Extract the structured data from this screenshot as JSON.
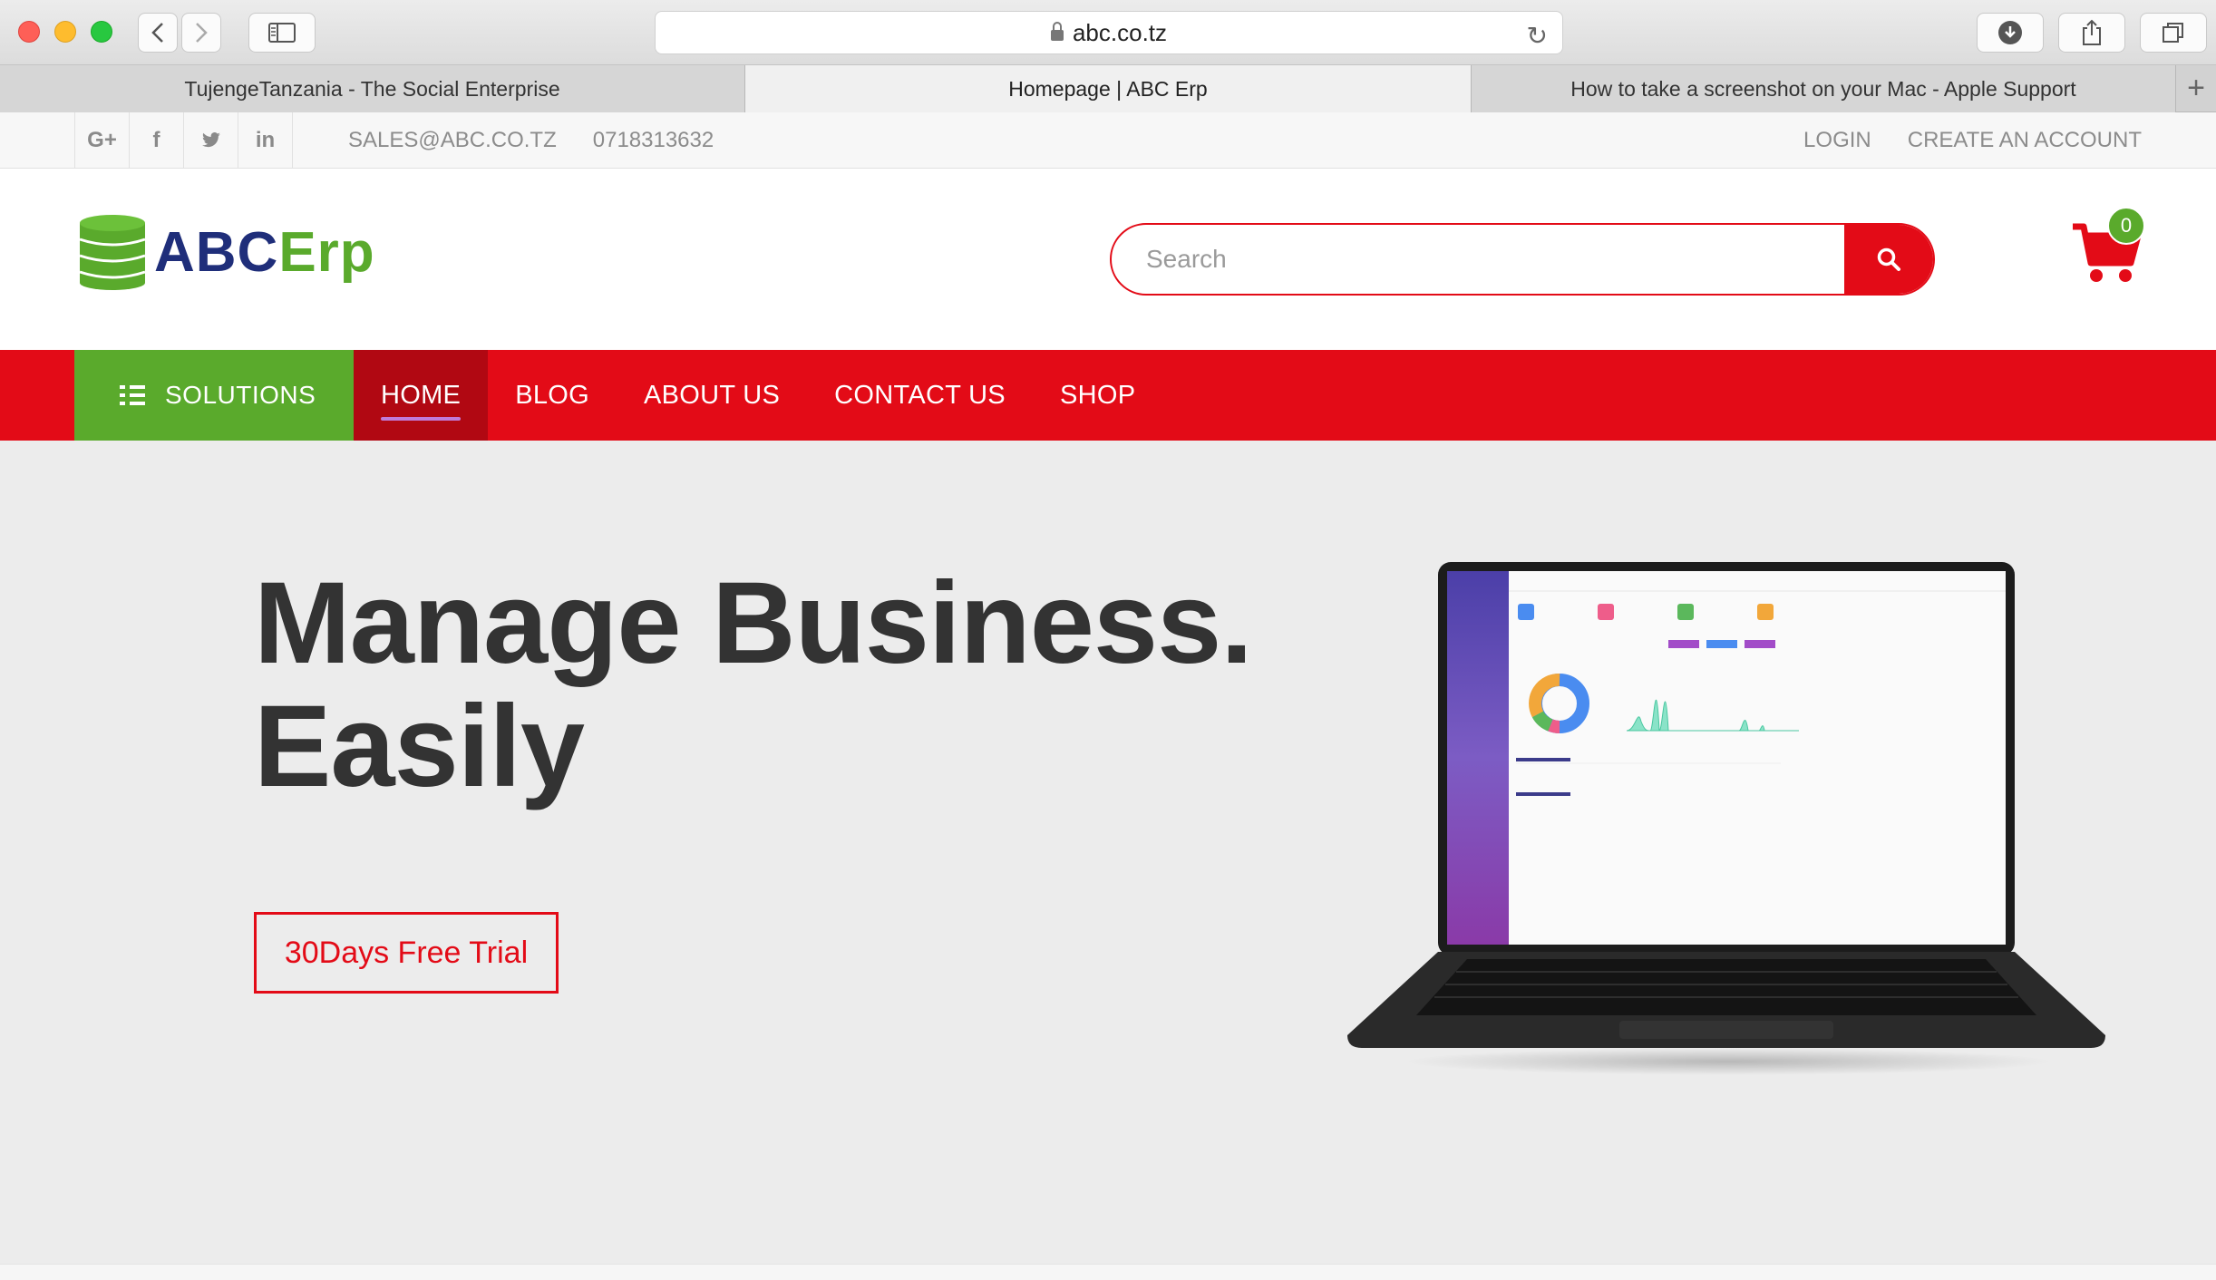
{
  "browser": {
    "url": "abc.co.tz",
    "tabs": [
      {
        "label": "TujengeTanzania - The Social Enterprise",
        "active": false
      },
      {
        "label": "Homepage | ABC Erp",
        "active": true
      },
      {
        "label": "How to take a screenshot on your Mac - Apple Support",
        "active": false
      }
    ],
    "icons": [
      "back-icon",
      "forward-icon",
      "sidebar-icon",
      "lock-icon",
      "reload-icon",
      "download-icon",
      "share-icon",
      "tabs-icon",
      "new-tab-icon"
    ]
  },
  "topbar": {
    "social": [
      {
        "icon": "google-plus-icon",
        "glyph": "G+"
      },
      {
        "icon": "facebook-icon",
        "glyph": "f"
      },
      {
        "icon": "twitter-icon",
        "glyph": "t"
      },
      {
        "icon": "linkedin-icon",
        "glyph": "in"
      }
    ],
    "email": "SALES@ABC.CO.TZ",
    "phone": "0718313632",
    "login": "LOGIN",
    "create_account": "CREATE AN ACCOUNT"
  },
  "header": {
    "logo_abc": "ABC",
    "logo_erp": "Erp",
    "search_placeholder": "Search",
    "cart_count": "0"
  },
  "nav": {
    "solutions": "SOLUTIONS",
    "items": [
      {
        "label": "HOME",
        "active": true
      },
      {
        "label": "BLOG",
        "active": false
      },
      {
        "label": "ABOUT US",
        "active": false
      },
      {
        "label": "CONTACT US",
        "active": false
      },
      {
        "label": "SHOP",
        "active": false
      }
    ]
  },
  "hero": {
    "title_line1": "Manage Business.",
    "title_line2": "Easily",
    "cta": "30Days Free Trial"
  },
  "colors": {
    "brand_red": "#e30b17",
    "brand_green": "#5aaa2c",
    "logo_blue": "#1f2e7a",
    "nav_active": "#b10812"
  }
}
